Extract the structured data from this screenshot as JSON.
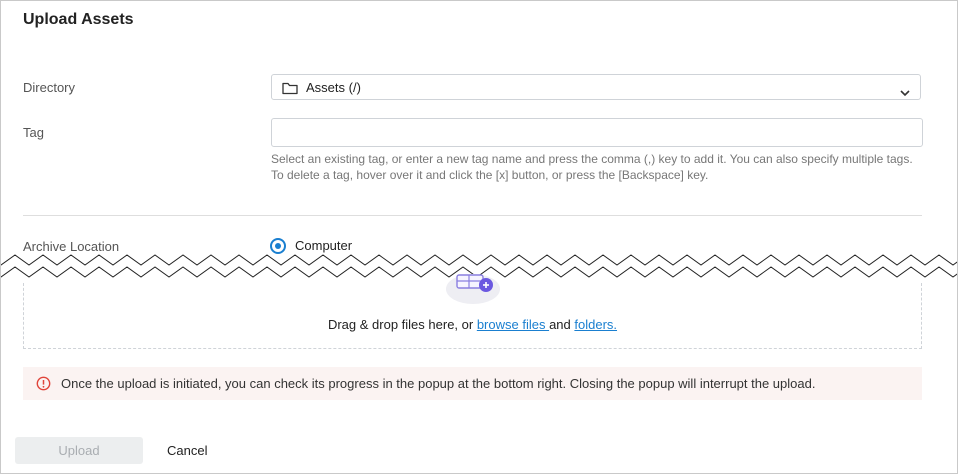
{
  "dialog": {
    "title": "Upload Assets"
  },
  "form": {
    "directory": {
      "label": "Directory",
      "value": "Assets (/)",
      "icon": "folder-icon"
    },
    "tag": {
      "label": "Tag",
      "value": "",
      "placeholder": "",
      "help_line1": "Select an existing tag, or enter a new tag name and press the comma (,) key to add it. You can also specify multiple tags.",
      "help_line2": "To delete a tag, hover over it and click the [x] button, or press the [Backspace] key."
    },
    "archive_location": {
      "label": "Archive Location",
      "option": "Computer",
      "selected": true
    }
  },
  "dropzone": {
    "text_prefix": "Drag & drop files here, or ",
    "browse_link": "browse files ",
    "conjunction": "and ",
    "folders_link": "folders."
  },
  "notice": {
    "message": "Once the upload is initiated, you can check its progress in the popup at the bottom right. Closing the popup will interrupt the upload.",
    "color": "#e0443a"
  },
  "actions": {
    "upload_label": "Upload",
    "cancel_label": "Cancel"
  },
  "colors": {
    "accent": "#1a7fd0",
    "notice_bg": "#fbf3f2",
    "disabled_bg": "#eceeef"
  }
}
